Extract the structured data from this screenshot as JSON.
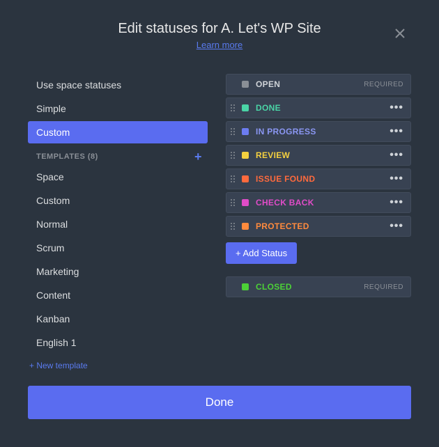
{
  "header": {
    "title": "Edit statuses for A. Let's WP Site",
    "learn_more": "Learn more"
  },
  "sidebar": {
    "items": [
      {
        "label": "Use space statuses",
        "active": false
      },
      {
        "label": "Simple",
        "active": false
      },
      {
        "label": "Custom",
        "active": true
      }
    ],
    "templates_header": "TEMPLATES (8)",
    "templates": [
      {
        "label": "Space"
      },
      {
        "label": "Custom"
      },
      {
        "label": "Normal"
      },
      {
        "label": "Scrum"
      },
      {
        "label": "Marketing"
      },
      {
        "label": "Content"
      },
      {
        "label": "Kanban"
      },
      {
        "label": "English 1"
      }
    ],
    "new_template": "+ New template"
  },
  "statuses": {
    "top": {
      "label": "OPEN",
      "color": "#8a8f96",
      "required": true,
      "required_label": "REQUIRED",
      "draggable": false,
      "label_color": "#cfd3d8"
    },
    "middle": [
      {
        "label": "DONE",
        "color": "#4ad4a6",
        "label_color": "#4ad4a6"
      },
      {
        "label": "IN PROGRESS",
        "color": "#6c7cf0",
        "label_color": "#8a96f2"
      },
      {
        "label": "REVIEW",
        "color": "#f4d03f",
        "label_color": "#f4d03f"
      },
      {
        "label": "ISSUE FOUND",
        "color": "#ff6a3d",
        "label_color": "#ff6a3d"
      },
      {
        "label": "CHECK BACK",
        "color": "#e04cc8",
        "label_color": "#e04cc8"
      },
      {
        "label": "PROTECTED",
        "color": "#ff8a3d",
        "label_color": "#ff8a3d"
      }
    ],
    "add_button": "+ Add Status",
    "bottom": {
      "label": "CLOSED",
      "color": "#4cd137",
      "required": true,
      "required_label": "REQUIRED",
      "draggable": false,
      "label_color": "#4cd137"
    }
  },
  "footer": {
    "done": "Done"
  }
}
